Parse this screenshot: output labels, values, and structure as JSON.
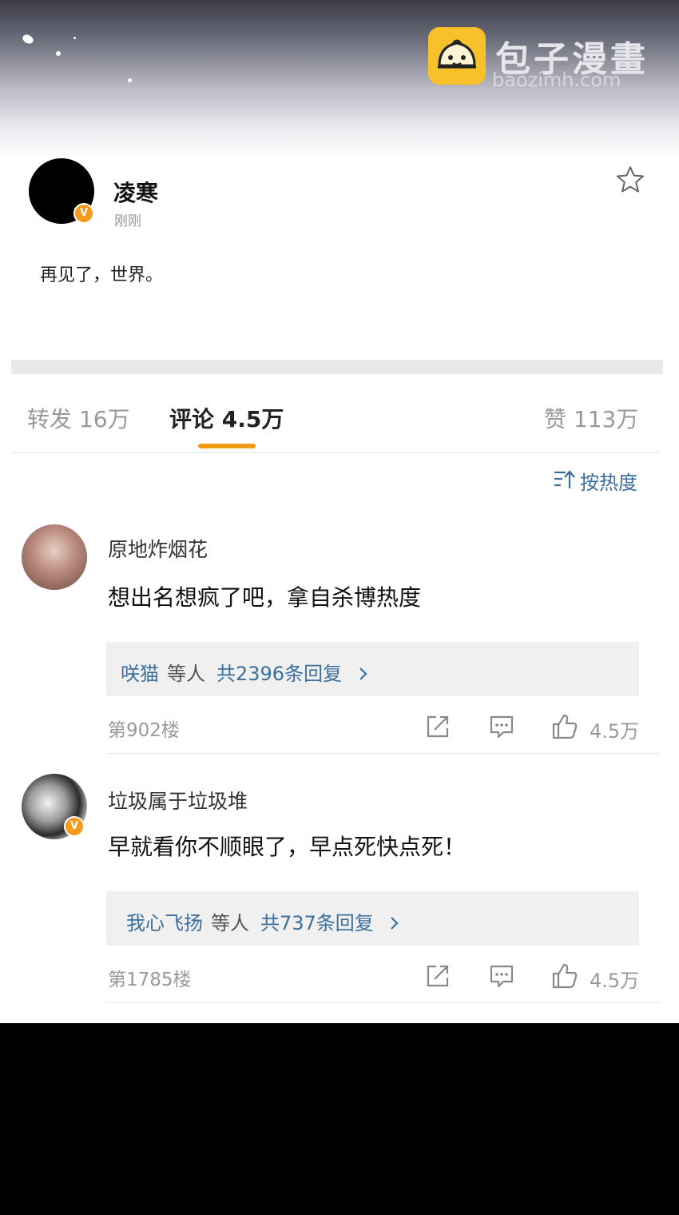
{
  "watermark": {
    "name": "包子漫畫",
    "site": "baozimh.com"
  },
  "post": {
    "username": "凌寒",
    "verified_badge": "V",
    "time": "刚刚",
    "text": "再见了，世界。"
  },
  "tabs": {
    "repost": "转发 16万",
    "comment": "评论 4.5万",
    "like": "赞 113万"
  },
  "sort_label": "按热度",
  "comments": [
    {
      "name": "原地炸烟花",
      "text": "想出名想疯了吧，拿自杀博热度",
      "reply_user": "咲猫",
      "reply_etc": "等人",
      "reply_total": "共2396条回复",
      "floor": "第902楼",
      "likes": "4.5万"
    },
    {
      "name": "垃圾属于垃圾堆",
      "verified_badge": "V",
      "text": "早就看你不顺眼了，早点死快点死！",
      "reply_user": "我心飞扬",
      "reply_etc": "等人",
      "reply_total": "共737条回复",
      "floor": "第1785楼",
      "likes": "4.5万"
    }
  ],
  "colors": {
    "accent": "#f39a17",
    "link": "#3b6f9e",
    "badge": "#f59a1a"
  }
}
